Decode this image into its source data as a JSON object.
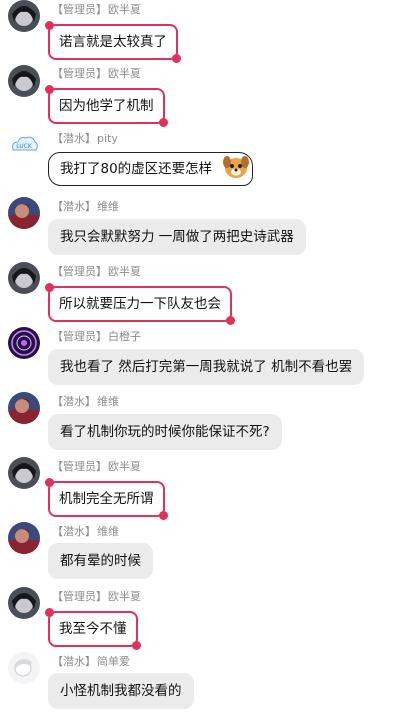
{
  "colors": {
    "admin_border": "#e0315a",
    "plain_bubble": "#ebebeb",
    "meta_text": "#8c8c8c"
  },
  "messages": [
    {
      "role": "【管理员】",
      "name": "欧半夏",
      "text": "诺言就是太较真了",
      "style": "admin",
      "avatar": "dark-hair-avatar"
    },
    {
      "role": "【管理员】",
      "name": "欧半夏",
      "text": "因为他学了机制",
      "style": "admin",
      "avatar": "dark-hair-avatar"
    },
    {
      "role": "【潜水】",
      "name": "pity",
      "text": "我打了80的虚区还要怎样",
      "style": "sketch",
      "avatar": "luck-cloud-avatar"
    },
    {
      "role": "【潜水】",
      "name": "维维",
      "text": "我只会默默努力 一周做了两把史诗武器",
      "style": "plain",
      "avatar": "red-character-avatar"
    },
    {
      "role": "【管理员】",
      "name": "欧半夏",
      "text": "所以就要压力一下队友也会",
      "style": "admin",
      "avatar": "dark-hair-avatar"
    },
    {
      "role": "【管理员】",
      "name": "白橙子",
      "text": "我也看了  然后打完第一周我就说了  机制不看也罢",
      "style": "plain",
      "avatar": "purple-magic-circle-avatar"
    },
    {
      "role": "【潜水】",
      "name": "维维",
      "text": "看了机制你玩的时候你能保证不死?",
      "style": "plain",
      "avatar": "red-character-avatar"
    },
    {
      "role": "【管理员】",
      "name": "欧半夏",
      "text": "机制完全无所谓",
      "style": "admin",
      "avatar": "dark-hair-avatar"
    },
    {
      "role": "【潜水】",
      "name": "维维",
      "text": "都有晕的时候",
      "style": "plain",
      "avatar": "red-character-avatar"
    },
    {
      "role": "【管理员】",
      "name": "欧半夏",
      "text": "我至今不懂",
      "style": "admin",
      "avatar": "dark-hair-avatar"
    },
    {
      "role": "【潜水】",
      "name": "简单爱",
      "text": "小怪机制我都没看的",
      "style": "plain",
      "avatar": "white-character-avatar"
    }
  ]
}
